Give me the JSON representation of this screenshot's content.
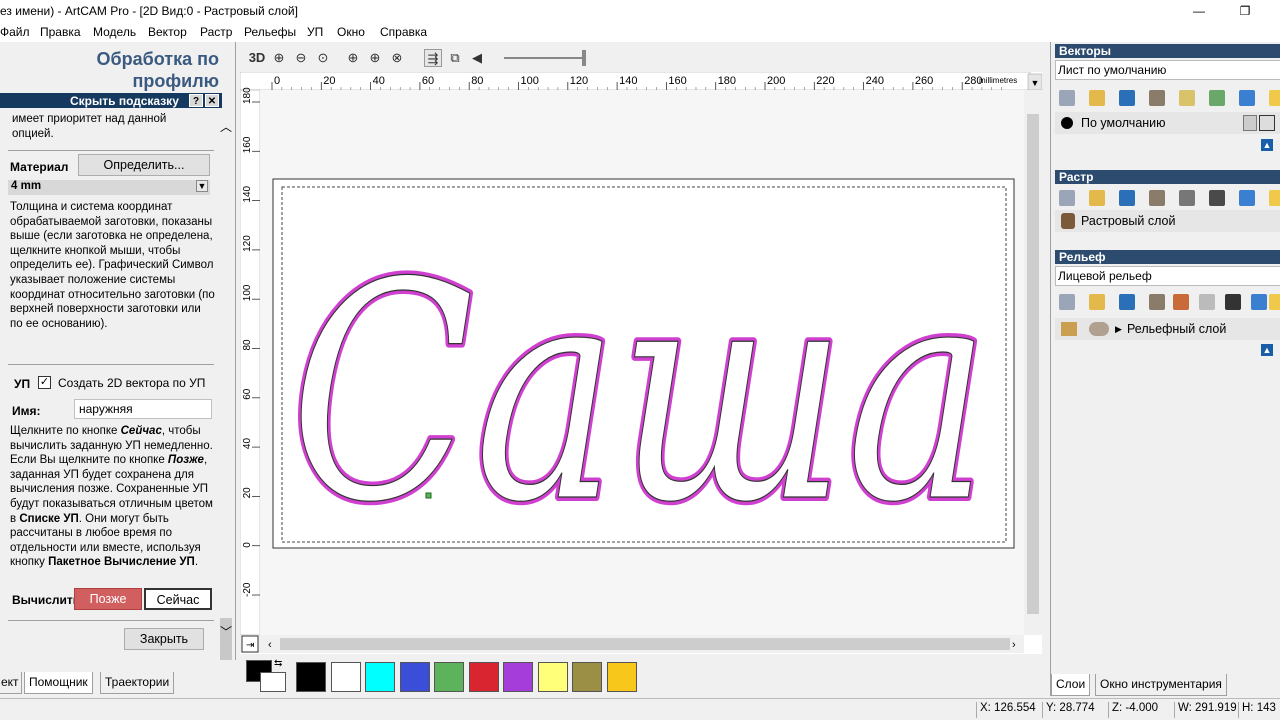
{
  "window": {
    "title": "ез имени) - ArtCAM Pro - [2D Вид:0 - Растровый слой]",
    "minimize": "—",
    "restore": "❐"
  },
  "menu": [
    "Файл",
    "Правка",
    "Модель",
    "Вектор",
    "Растр",
    "Рельефы",
    "УП",
    "Окно",
    "Справка"
  ],
  "left_panel": {
    "title": "Обработка по профилю",
    "hint_bar": "Скрыть подсказку",
    "hint_help": "?",
    "hint_close": "✕",
    "hint_text": "имеет приоритет над данной опцией.",
    "material_label": "Материал",
    "define_button": "Определить...",
    "material_value": "4 mm",
    "material_desc": "Толщина и система координат обрабатываемой заготовки, показаны выше (если заготовка не определена, щелкните кнопкой мыши, чтобы определить ее). Графический Символ указывает положение системы координат относительно заготовки (по верхней поверхности заготовки или по ее основанию).",
    "up_label": "УП",
    "create_2d_label": "Создать 2D вектора по УП",
    "name_label": "Имя:",
    "name_value": "наружняя",
    "calc_desc_1": "Щелкните по кнопке ",
    "calc_desc_now": "Сейчас",
    "calc_desc_2": ", чтобы вычислить заданную УП немедленно. Если Вы щелкните по кнопке ",
    "calc_desc_later": "Позже",
    "calc_desc_3": ", заданная УП будет сохранена для вычисления позже. Сохраненные УП будут показываться отличным цветом в ",
    "calc_desc_list": "Списке УП",
    "calc_desc_4": ". Они могут быть рассчитаны в любое время по отдельности или вместе, используя кнопку ",
    "calc_desc_batch": "Пакетное Вычисление УП",
    "calc_desc_5": ".",
    "calc_label": "Вычислить",
    "later_button": "Позже",
    "now_button": "Сейчас",
    "close_button": "Закрыть",
    "tabs": [
      "ект",
      "Помощник",
      "Траектории"
    ]
  },
  "toolbar": {
    "label_3d": "3D"
  },
  "ruler": {
    "units": "millimetres",
    "x_ticks": [
      "0",
      "20",
      "40",
      "60",
      "80",
      "100",
      "120",
      "140",
      "160",
      "180",
      "200",
      "220",
      "240",
      "260",
      "280"
    ],
    "y_ticks": [
      "180",
      "160",
      "140",
      "120",
      "100",
      "80",
      "60",
      "40",
      "20",
      "0",
      "-20"
    ]
  },
  "canvas": {
    "text": "Саша"
  },
  "palette": {
    "colors": [
      "#000000",
      "#ffffff",
      "#00ffff",
      "#3b4ed8",
      "#5cb35c",
      "#d9252f",
      "#a43dd9",
      "#ffff7a",
      "#9b8f45",
      "#f8c71b"
    ]
  },
  "right_panel": {
    "vectors_head": "Векторы",
    "vectors_sheet": "Лист по умолчанию",
    "vectors_layer": "По умолчанию",
    "raster_head": "Растр",
    "raster_layer": "Растровый слой",
    "relief_head": "Рельеф",
    "relief_select": "Лицевой рельеф",
    "relief_layer": "Рельефный слой",
    "tabs": [
      "Слои",
      "Окно инструментария"
    ]
  },
  "status": {
    "x": "X: 126.554",
    "y": "Y: 28.774",
    "z": "Z: -4.000",
    "w": "W: 291.919",
    "h": "H: 143"
  }
}
